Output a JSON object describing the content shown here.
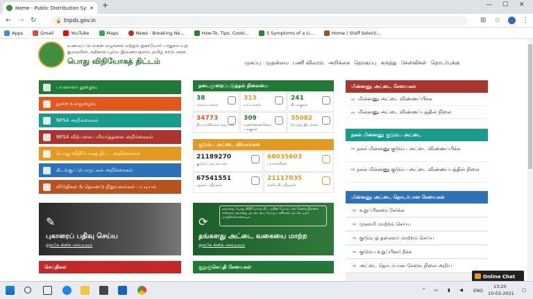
{
  "browser": {
    "tab_title": "Home - Public Distribution Syste",
    "new_tab": "+",
    "url": "tnpds.gov.in",
    "bookmarks": [
      {
        "label": "Apps",
        "color": "#4285f4"
      },
      {
        "label": "Gmail",
        "color": "#ea4335"
      },
      {
        "label": "YouTube",
        "color": "#ff0000"
      },
      {
        "label": "Maps",
        "color": "#34a853"
      },
      {
        "label": "News - Breaking Ne...",
        "color": "#c62828"
      },
      {
        "label": "How-To, Tips, Cooki...",
        "color": "#2e7d32"
      },
      {
        "label": "5 Symptoms of a Li...",
        "color": "#2e7d32"
      },
      {
        "label": "Home | Staff Selecti...",
        "color": "#8e5a2a"
      }
    ]
  },
  "header": {
    "line1": "உணவுப் பொருள் வழங்கல் மற்றும் நுகர்வோர் பாதுகாப்புத்",
    "line2": "துறையின் அதிகாரப்பூர்வ இணையதளம், தமிழ் நாடு அரசு",
    "title": "பொது விநியோகத் திட்டம்",
    "nav": [
      "முகப்பு",
      "முதன்மை",
      "பணி விவரம்",
      "அறிக்கை",
      "தொகுப்பு",
      "கருத்து",
      "கேள்விகள்",
      "தொடர்புக்கு"
    ]
  },
  "left_menu": [
    {
      "label": "பயனாளர் நுழைவு",
      "color": "#1e7a34"
    },
    {
      "label": "துறை உள்நுழைவு",
      "color": "#e0581c"
    },
    {
      "label": "NFSA அறிக்கைகள்",
      "color": "#1a9c8c"
    },
    {
      "label": "NFSA விற்பனை பரிவர்த்தனை அறிக்கைகள்",
      "color": "#a8362e"
    },
    {
      "label": "பொது விநியோகத் திட்ட அறிக்கைகள்",
      "color": "#e39a1f"
    },
    {
      "label": "கிடங்குப் பொருட்கள் அறிக்கைகள்",
      "color": "#2b72b8"
    },
    {
      "label": "விடுதிகள் & தொண்டு நிறுவனங்கள் பட்டியல்",
      "color": "#b8521e"
    }
  ],
  "status": {
    "title": "நடைமுறைப்படுத்தல் நிலைமை",
    "items": [
      {
        "num": "38",
        "label": "மாவட்டங்கள்",
        "color": "#1e7a34"
      },
      {
        "num": "313",
        "label": "வட்டங்கள்",
        "color": "#e39a1f"
      },
      {
        "num": "241",
        "label": "கிடங்குகள்",
        "color": "#1e7a34"
      },
      {
        "num": "34773",
        "label": "நியாயவிலைக் கடைகள்",
        "color": "#e0581c"
      },
      {
        "num": "309",
        "label": "மண்ணெண்ணெய் பங்குகள்",
        "color": "#1e7a34"
      },
      {
        "num": "35082",
        "label": "மொத்த இடங்கள்",
        "color": "#e39a1f"
      }
    ]
  },
  "family": {
    "title": "குடும்ப அட்டை விவரங்கள்",
    "items": [
      {
        "num": "21189270",
        "label": "குடும்ப அட்டைகள்",
        "color": "#222"
      },
      {
        "num": "68035603",
        "label": "பயனாளிகள்",
        "color": "#e39a1f"
      },
      {
        "num": "67541551",
        "label": "ஆதார் பதிவுகள்",
        "color": "#222"
      },
      {
        "num": "21117035",
        "label": "கைபேசி பதிவுகள்",
        "color": "#e39a1f"
      }
    ]
  },
  "right": {
    "ecard_title": "மின்னணு அட்டை சேவைகள்",
    "ecard_links": [
      "மின்னணு அட்டை விண்ணப்பிக்க",
      "மின்னணு அட்டை விண்ணப்பத்தின் நிலை"
    ],
    "copy_title": "நகல் மின்னணு குடும்ப அட்டை",
    "copy_links": [
      "நகல் மின்னணு குடும்ப அட்டை விண்ணப்பிக்க",
      "நகல் மின்னணு குடும்ப அட்டை விண்ணப்பத்தின் நிலை"
    ],
    "related_title": "மின்னணு அட்டை தொடர்பான சேவைகள்",
    "related_links": [
      "உறுப்பினரை சேர்க்க",
      "முகவரி மாற்றம் செய்ய",
      "குடும்பத் தலைவர் மாற்றம் செய்ய",
      "குடும்ப உறுப்பினர் நீக்க",
      "அட்டை தொடர்பான சேவை நிலை அறிய"
    ]
  },
  "banners": {
    "complaint_title": "புகாரைப் பதிவு செய்ய",
    "complaint_sub": "இங்கே கிளிக் செய்யவும்",
    "cardtype_title": "தங்களது அட்டை வகையை மாற்ற",
    "cardtype_sub": "இங்கே கிளிக் செய்யவும்",
    "cardtype_note": "தங்களது பொது விநியோகத் திட்டத்தின் பொருட்கள் தேவையில்லை என்றால் தங்களது அட்டையை பொருட்களில்லா அட்டையாக மாற்றிக்கொள்ளவும்"
  },
  "bottom": {
    "news_title": "செய்திகள்",
    "sms_title": "குறுஞ்செய்தி சேவைகள்"
  },
  "chat": {
    "label": "Online Chat"
  },
  "taskbar": {
    "lang": "ENG",
    "time": "13:20",
    "date": "10-03-2021"
  }
}
